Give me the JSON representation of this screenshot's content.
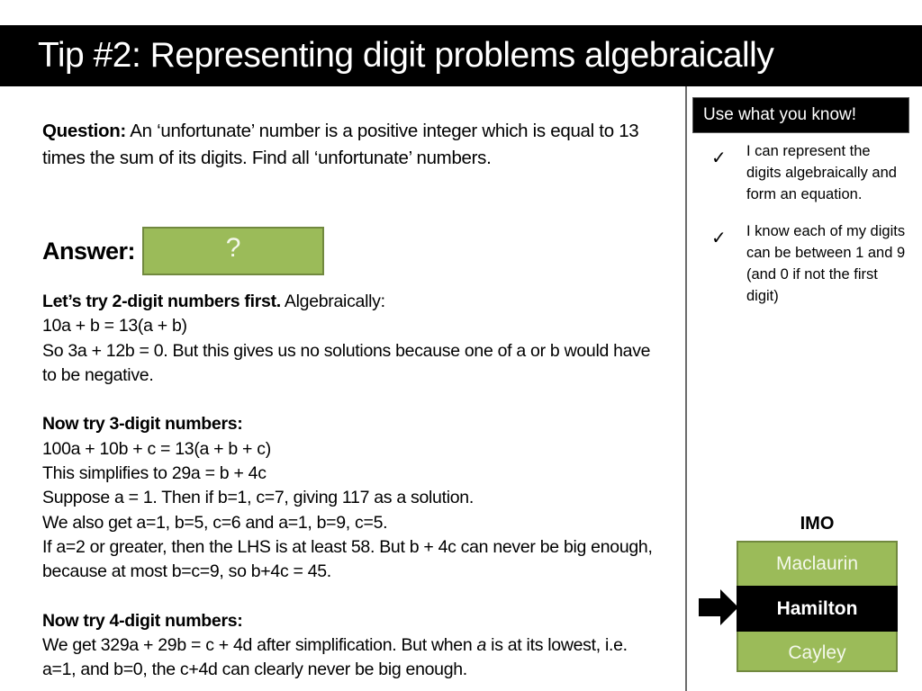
{
  "title": "Tip #2: Representing digit problems algebraically",
  "question": {
    "label": "Question:",
    "text": " An ‘unfortunate’ number is a positive integer which is equal to 13 times the sum of its digits. Find all ‘unfortunate’ numbers."
  },
  "answer": {
    "label": "Answer:",
    "hidden_value": "?"
  },
  "working": {
    "two_digit": {
      "heading": "Let’s try 2-digit numbers first.",
      "heading_suffix": " Algebraically:",
      "lines": [
        "10a + b = 13(a + b)",
        "So 3a + 12b = 0. But this gives us no solutions because one of a or b would have to be negative."
      ]
    },
    "three_digit": {
      "heading": "Now try 3-digit numbers:",
      "lines": [
        "100a + 10b + c = 13(a + b + c)",
        "This simplifies to 29a = b + 4c",
        "Suppose a = 1. Then if b=1, c=7, giving 117 as a solution.",
        "We also get a=1, b=5, c=6 and a=1, b=9, c=5.",
        "If a=2 or greater, then the LHS is at least 58. But b + 4c can never be big enough, because at most b=c=9, so b+4c = 45."
      ]
    },
    "four_digit": {
      "heading": "Now try 4-digit numbers:",
      "line_part1": "We get 329a + 29b = c + 4d after simplification. But when ",
      "line_italic": "a",
      "line_part2": " is at its lowest, i.e. a=1, and b=0, the c+4d can clearly never be big enough."
    }
  },
  "sidebar": {
    "header": "Use what you know!",
    "hints": [
      {
        "icon": "check-icon",
        "glyph": "✓",
        "text": "I can represent the digits algebraically and form an equation."
      },
      {
        "icon": "check-icon",
        "glyph": "✓",
        "text": "I know each of my digits can be between 1 and 9 (and 0 if not the first digit)"
      }
    ],
    "competition": {
      "title": "IMO",
      "levels": [
        "Maclaurin",
        "Hamilton",
        "Cayley"
      ],
      "selected": "Hamilton"
    }
  },
  "colors": {
    "green": "#9bbb59",
    "green_border": "#71893f",
    "black": "#000000"
  }
}
